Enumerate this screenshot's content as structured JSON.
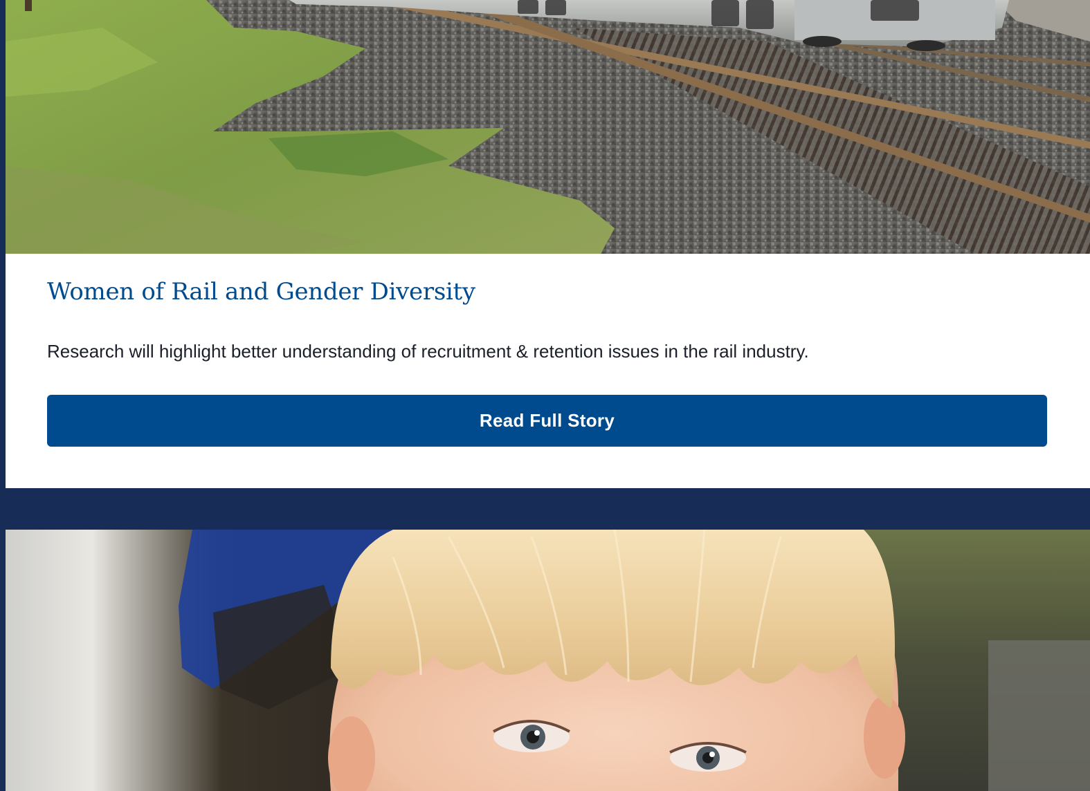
{
  "story_card_1": {
    "image_alt": "Freight train cars on railroad tracks beside gravel ballast and grass",
    "title": "Women of Rail and Gender Diversity",
    "description": "Research will highlight better understanding of recruitment & retention issues in the rail industry.",
    "button_label": "Read Full Story"
  },
  "story_card_2": {
    "image_alt": "Close-up of a smiling blond-haired child"
  },
  "colors": {
    "page_background": "#172d57",
    "title_text": "#004b8e",
    "button_background": "#004b8e",
    "button_text": "#ffffff",
    "body_text": "#1b1f2a"
  }
}
